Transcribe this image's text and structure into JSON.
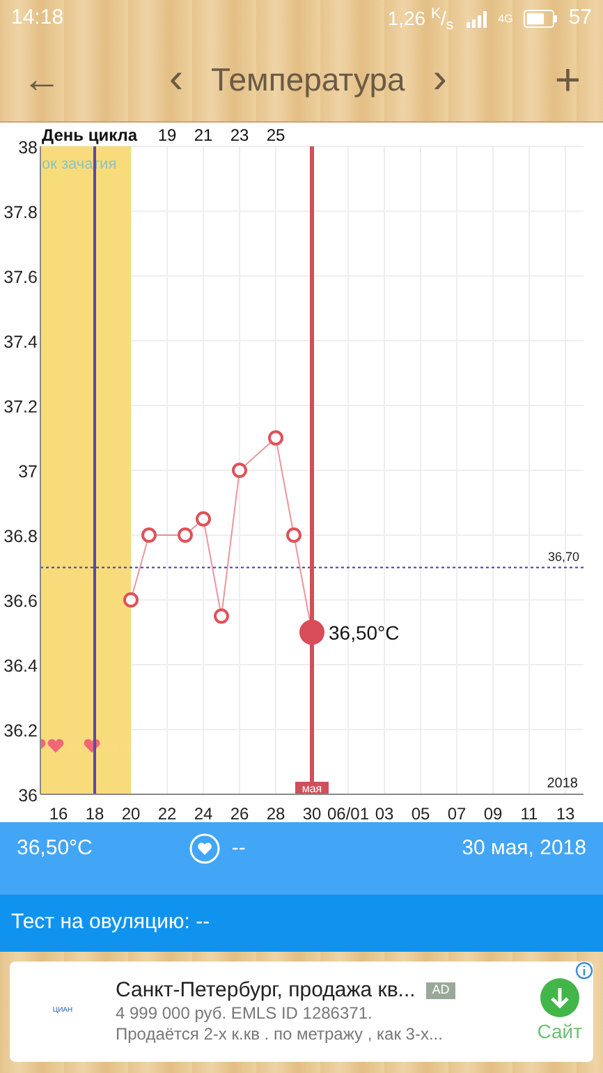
{
  "status_bar": {
    "time": "14:18",
    "speed": "1,26 $^{K}$/$_{s}$",
    "network": "4G",
    "battery": "57"
  },
  "header": {
    "back": "←",
    "prev": "‹",
    "title": "Температура",
    "next": "›",
    "add": "+"
  },
  "chart": {
    "cycle_axis": {
      "title": "День цикла",
      "labels": [
        "19",
        "21",
        "23",
        "25"
      ]
    },
    "next_month_ticks": [
      "06/01",
      "03",
      "05",
      "07",
      "09",
      "11",
      "13"
    ],
    "intercourse_days": [
      {
        "on": true
      },
      {
        "on": true
      },
      {
        "on": false
      },
      {
        "on": true
      },
      {
        "on": false
      },
      {
        "on": false
      }
    ],
    "chart_data": {
      "type": "line",
      "x": [
        20,
        21,
        23,
        24,
        25,
        26,
        28,
        29,
        30
      ],
      "series": [
        {
          "color": "#e0505a",
          "marker": "o",
          "values": [
            36.6,
            36.8,
            36.8,
            36.85,
            36.55,
            37.0,
            37.1,
            36.8,
            36.5
          ]
        }
      ],
      "xlim": [
        15,
        45
      ],
      "ylim": [
        36,
        38
      ],
      "grid": true,
      "xticks": [
        16,
        18,
        20,
        22,
        24,
        26,
        28,
        30
      ],
      "yticks": [
        36,
        36.2,
        36.4,
        36.6,
        36.8,
        37,
        37.2,
        37.4,
        37.6,
        37.8,
        38
      ],
      "bands": [
        {
          "axis": "x",
          "from": 15,
          "to": 20,
          "label": "ок зачатия",
          "color": "#f8dc7c"
        }
      ],
      "ref_lines": [
        {
          "axis": "x",
          "value": 18,
          "color": "#5a4aa8"
        },
        {
          "axis": "y",
          "value": 36.7,
          "label": "36,70",
          "color": "#3b3bb0"
        },
        {
          "axis": "x",
          "value": 30,
          "color": "#d14f5b"
        }
      ],
      "annotations": [
        {
          "x": 30,
          "y": 36.5,
          "text": "36,50°C"
        },
        {
          "text": "мая"
        },
        {
          "text": "2018"
        }
      ]
    }
  },
  "summary": {
    "temperature": "36,50°C",
    "intercourse": "--",
    "date": "30 мая, 2018"
  },
  "ovulation": {
    "label": "Тест на овуляцию: --"
  },
  "ad": {
    "logo": "ЦИАН",
    "title": "Санкт-Петербург, продажа кв...",
    "badge": "AD",
    "line1": "4 999 000 руб. EMLS ID 1286371.",
    "line2": "Продаётся 2-х к.кв . по метражу , как 3-х...",
    "action": "Сайт"
  }
}
